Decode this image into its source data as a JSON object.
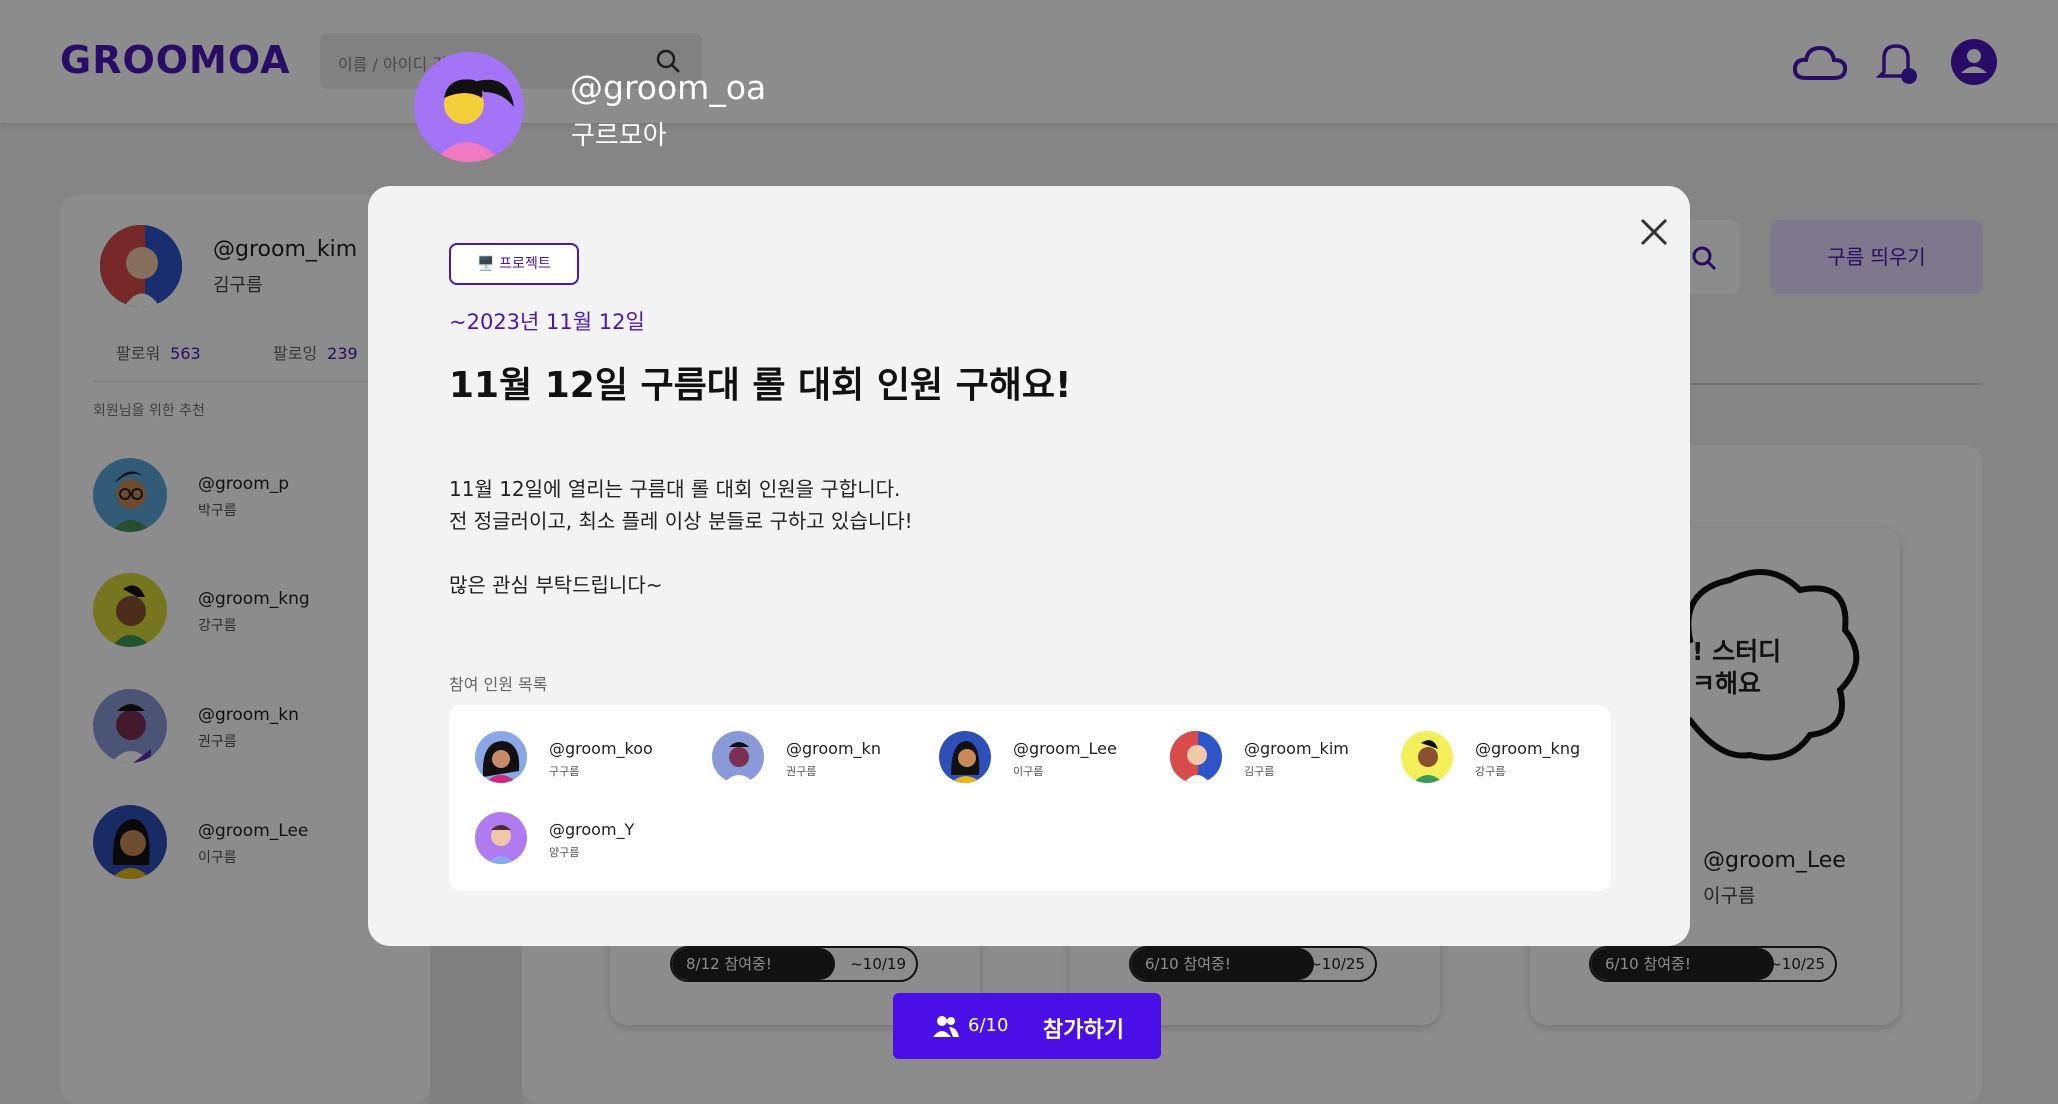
{
  "header": {
    "logo": "GROOMOA",
    "search_placeholder": "이름 / 아이디 검색"
  },
  "current_user": {
    "handle": "@groom_oa",
    "name": "구르모아"
  },
  "sidebar": {
    "profile": {
      "handle": "@groom_kim",
      "name": "김구름"
    },
    "followers_label": "팔로워",
    "followers_count": "563",
    "following_label": "팔로잉",
    "following_count": "239",
    "recommend_title": "회원님을 위한 추천",
    "recommendations": [
      {
        "handle": "@groom_p",
        "name": "박구름"
      },
      {
        "handle": "@groom_kng",
        "name": "강구름"
      },
      {
        "handle": "@groom_kn",
        "name": "권구름"
      },
      {
        "handle": "@groom_Lee",
        "name": "이구름"
      }
    ]
  },
  "toolbar": {
    "create_label": "구름 띄우기"
  },
  "feed": {
    "cards": [
      {
        "progress": "8/12 참여중!",
        "deadline": "~10/19",
        "fraction": 0.67
      },
      {
        "progress": "6/10 참여중!",
        "deadline": "~10/25",
        "fraction": 0.75
      },
      {
        "progress": "6/10 참여중!",
        "deadline": "~10/25",
        "fraction": 0.75,
        "cloud_text_1": "! 스터디",
        "cloud_text_2": "ㅋ해요",
        "handle": "@groom_Lee",
        "name": "이구름"
      }
    ]
  },
  "modal": {
    "tag": "🖥️ 프로젝트",
    "deadline": "~2023년 11월 12일",
    "title": "11월 12일 구름대 롤 대회 인원 구해요!",
    "body_lines": [
      "11월 12일에 열리는 구름대 롤 대회 인원을 구합니다.",
      "전 정글러이고, 최소 플레 이상 분들로 구하고 있습니다!",
      "",
      "많은 관심 부탁드립니다~"
    ],
    "participants_title": "참여 인원 목록",
    "participants": [
      {
        "handle": "@groom_koo",
        "name": "구구름"
      },
      {
        "handle": "@groom_kn",
        "name": "권구름"
      },
      {
        "handle": "@groom_Lee",
        "name": "이구름"
      },
      {
        "handle": "@groom_kim",
        "name": "김구름"
      },
      {
        "handle": "@groom_kng",
        "name": "강구름"
      },
      {
        "handle": "@groom_Y",
        "name": "양구름"
      }
    ]
  },
  "join": {
    "count": "6/10",
    "label": "참가하기"
  },
  "colors": {
    "accent": "#4a16b8",
    "button": "#4a0fe6",
    "overlay": "rgba(0,0,0,0.45)"
  }
}
